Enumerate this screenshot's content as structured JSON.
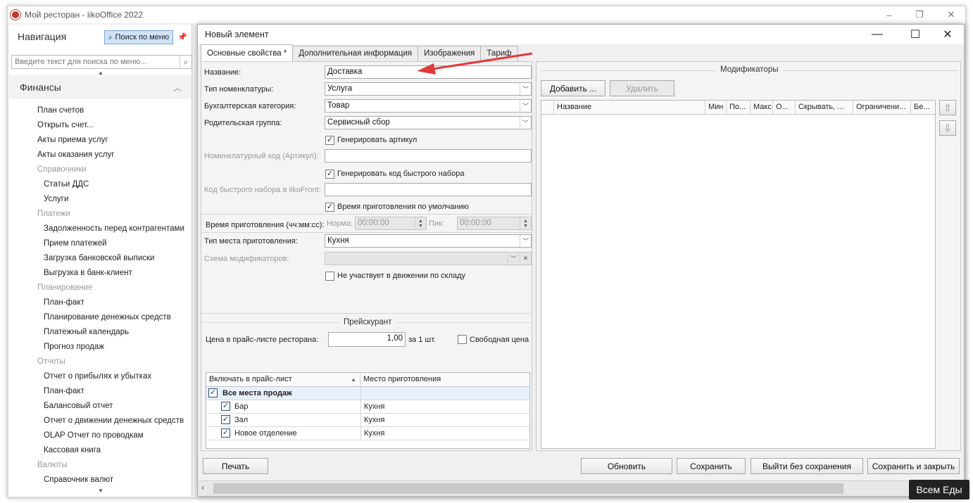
{
  "app": {
    "title": "Мой ресторан - iikoOffice 2022",
    "window_controls": [
      "–",
      "❐",
      "✕"
    ]
  },
  "nav": {
    "title": "Навигация",
    "search_button": "Поиск по меню",
    "search_placeholder": "Введите текст для поиска по меню...",
    "group": "Финансы",
    "items": [
      {
        "label": "План счетов",
        "kind": "l1"
      },
      {
        "label": "Открыть счет...",
        "kind": "l1"
      },
      {
        "label": "Акты приема услуг",
        "kind": "l1"
      },
      {
        "label": "Акты оказания услуг",
        "kind": "l1"
      },
      {
        "label": "Справочники",
        "kind": "cat"
      },
      {
        "label": "Статьи ДДС",
        "kind": "l2"
      },
      {
        "label": "Услуги",
        "kind": "l2"
      },
      {
        "label": "Платежи",
        "kind": "cat"
      },
      {
        "label": "Задолженность перед контрагентами",
        "kind": "l2"
      },
      {
        "label": "Прием платежей",
        "kind": "l2"
      },
      {
        "label": "Загрузка банковской выписки",
        "kind": "l2"
      },
      {
        "label": "Выгрузка в банк-клиент",
        "kind": "l2"
      },
      {
        "label": "Планирование",
        "kind": "cat"
      },
      {
        "label": "План-факт",
        "kind": "l2"
      },
      {
        "label": "Планирование денежных средств",
        "kind": "l2"
      },
      {
        "label": "Платежный календарь",
        "kind": "l2"
      },
      {
        "label": "Прогноз продаж",
        "kind": "l2"
      },
      {
        "label": "Отчеты",
        "kind": "cat"
      },
      {
        "label": "Отчет о прибылях и убытках",
        "kind": "l2"
      },
      {
        "label": "План-факт",
        "kind": "l2"
      },
      {
        "label": "Балансовый отчет",
        "kind": "l2"
      },
      {
        "label": "Отчет о движении денежных средств",
        "kind": "l2"
      },
      {
        "label": "OLAP Отчет по проводкам",
        "kind": "l2"
      },
      {
        "label": "Кассовая книга",
        "kind": "l2"
      },
      {
        "label": "Валюты",
        "kind": "cat"
      },
      {
        "label": "Справочник валют",
        "kind": "l2"
      }
    ]
  },
  "dialog": {
    "title": "Новый элемент",
    "tabs": [
      "Основные свойства *",
      "Дополнительная информация",
      "Изображения",
      "Тариф"
    ],
    "form": {
      "name_label": "Название:",
      "name_value": "Доставка",
      "type_label": "Тип номенклатуры:",
      "type_value": "Услуга",
      "acc_label": "Бухгалтерская категория:",
      "acc_value": "Товар",
      "parent_label": "Родительская группа:",
      "parent_value": "Сервисный сбор",
      "gen_article": "Генерировать артикул",
      "article_label": "Номенклатурный код (Артикул):",
      "gen_fastcode": "Генерировать код быстрого набора",
      "fastcode_label": "Код быстрого набора в iikoFront:",
      "default_time": "Время приготовления по умолчанию",
      "time_label": "Время приготовления (чч:мм:сс):",
      "norm_label": "Норма:",
      "norm_value": "00:00:00",
      "peak_label": "Пик:",
      "peak_value": "00:00:00",
      "place_label": "Тип места приготовления:",
      "place_value": "Кухня",
      "scheme_label": "Схема модификаторов:",
      "no_stock": "Не участвует в движении по складу"
    },
    "price": {
      "title": "Прейскурант",
      "price_label": "Цена в прайс-листе ресторана:",
      "price_value": "1,00",
      "per_unit": "за 1 шт.",
      "free_price": "Свободная цена",
      "col_include": "Включать в прайс-лист",
      "col_place": "Место приготовления",
      "group_row": "Все места продаж",
      "rows": [
        {
          "name": "Бар",
          "place": "Кухня"
        },
        {
          "name": "Зал",
          "place": "Кухня"
        },
        {
          "name": "Новое отделение",
          "place": "Кухня"
        }
      ]
    },
    "modifiers": {
      "title": "Модификаторы",
      "add": "Добавить ...",
      "remove": "Удалить",
      "columns": [
        "Название",
        "Мин",
        "По...",
        "Макс",
        "О...",
        "Скрывать, ...",
        "Ограничени...",
        "Бе..."
      ]
    },
    "buttons": {
      "print": "Печать",
      "refresh": "Обновить",
      "save": "Сохранить",
      "exit": "Выйти без сохранения",
      "save_close": "Сохранить и закрыть"
    }
  },
  "watermark": "Всем Еды",
  "colors": {
    "arrow": "#e03c3c",
    "accent": "#cfe3f7",
    "selected_row": "#e8f1fb"
  }
}
